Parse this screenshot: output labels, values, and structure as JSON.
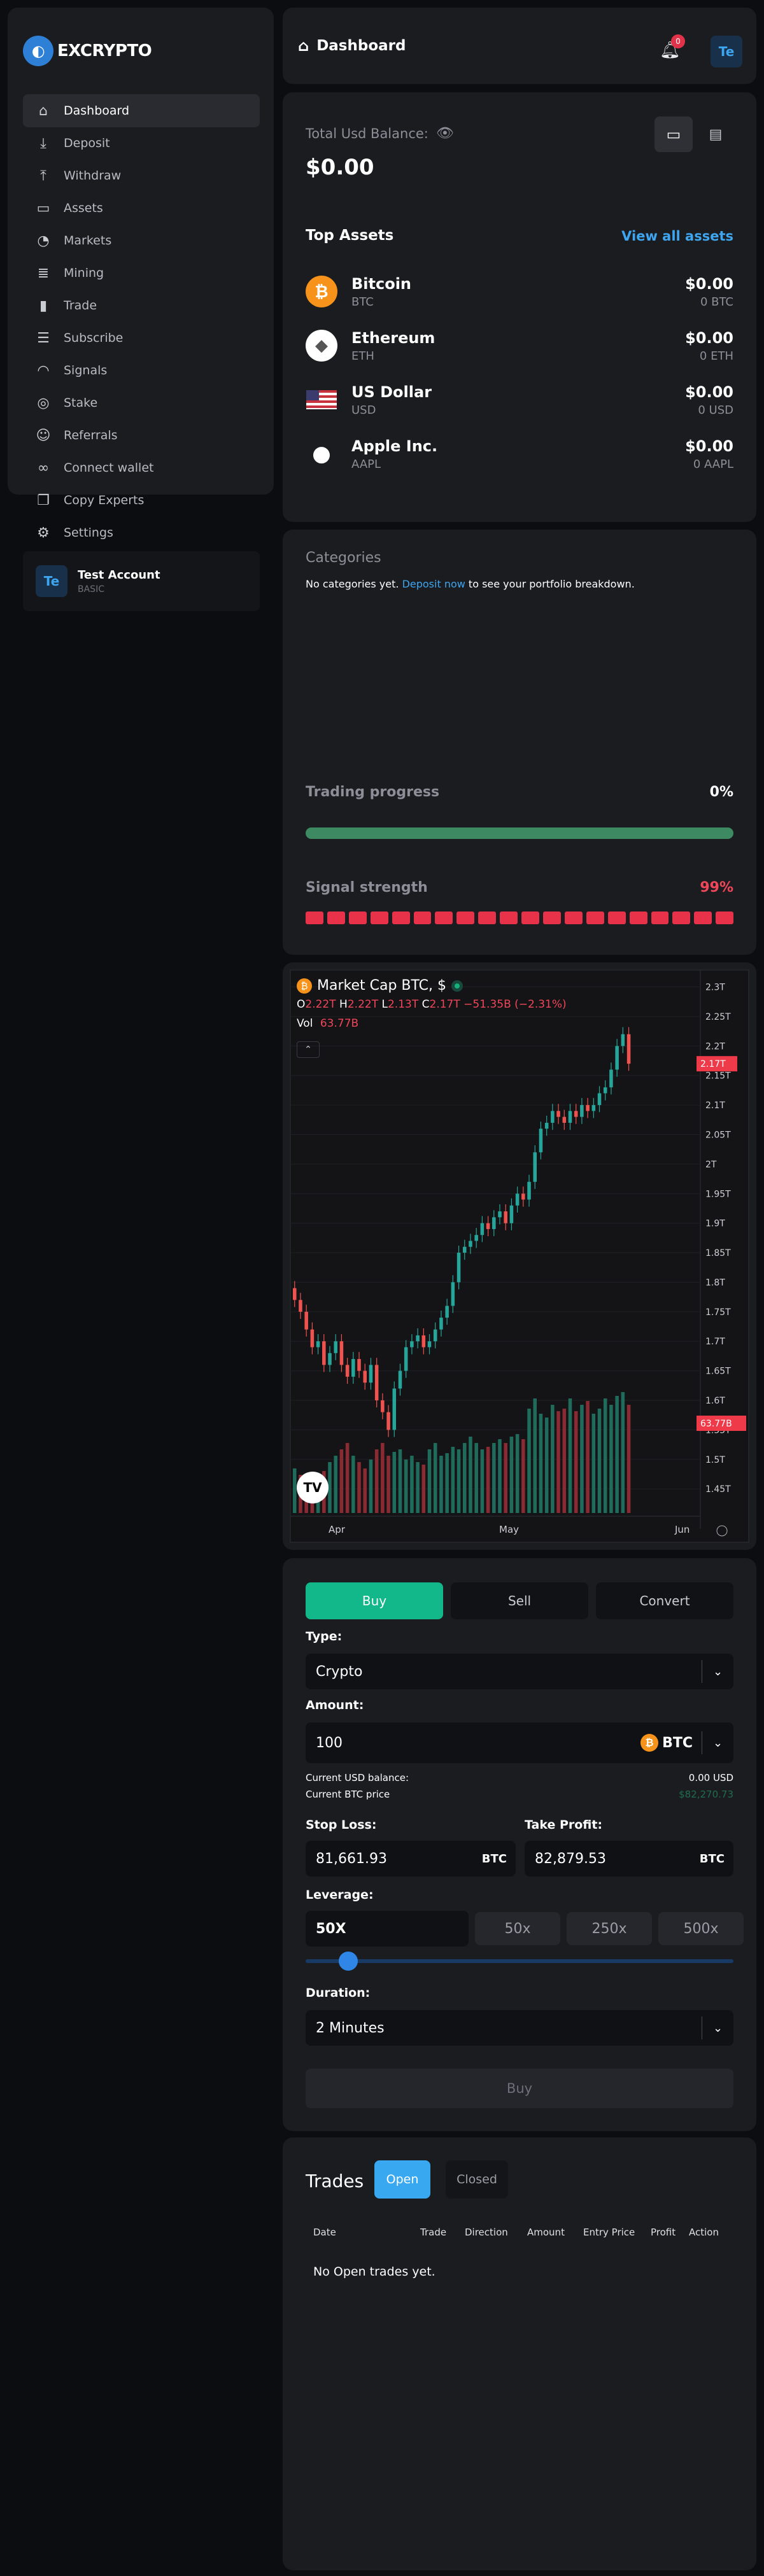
{
  "sidebar": {
    "brand": "EXCRYPTO",
    "items": [
      {
        "label": "Dashboard",
        "icon": "home-icon"
      },
      {
        "label": "Deposit",
        "icon": "deposit-icon"
      },
      {
        "label": "Withdraw",
        "icon": "withdraw-icon"
      },
      {
        "label": "Assets",
        "icon": "wallet-icon"
      },
      {
        "label": "Markets",
        "icon": "pie-chart-icon"
      },
      {
        "label": "Mining",
        "icon": "database-icon"
      },
      {
        "label": "Trade",
        "icon": "bar-chart-icon"
      },
      {
        "label": "Subscribe",
        "icon": "server-icon"
      },
      {
        "label": "Signals",
        "icon": "wifi-icon"
      },
      {
        "label": "Stake",
        "icon": "coins-icon"
      },
      {
        "label": "Referrals",
        "icon": "users-icon"
      },
      {
        "label": "Connect wallet",
        "icon": "link-icon"
      },
      {
        "label": "Copy Experts",
        "icon": "copy-icon"
      },
      {
        "label": "Settings",
        "icon": "gear-icon"
      }
    ],
    "account": {
      "avatar": "Te",
      "name": "Test Account",
      "tier": "BASIC"
    }
  },
  "topbar": {
    "title": "Dashboard",
    "notifications": "0",
    "avatar": "Te"
  },
  "balance": {
    "label": "Total Usd Balance:",
    "value": "$0.00",
    "top_assets_title": "Top Assets",
    "view_all": "View all assets",
    "assets": [
      {
        "name": "Bitcoin",
        "symbol": "BTC",
        "value": "$0.00",
        "amount": "0 BTC",
        "color": "#f7931a",
        "glyph": "₿"
      },
      {
        "name": "Ethereum",
        "symbol": "ETH",
        "value": "$0.00",
        "amount": "0 ETH",
        "color": "#ffffff",
        "glyph": "◆"
      },
      {
        "name": "US Dollar",
        "symbol": "USD",
        "value": "$0.00",
        "amount": "0 USD",
        "color": "#ffffff",
        "glyph": ""
      },
      {
        "name": "Apple Inc.",
        "symbol": "AAPL",
        "value": "$0.00",
        "amount": "0 AAPL",
        "color": "#1b1c20",
        "glyph": ""
      }
    ]
  },
  "categories": {
    "title": "Categories",
    "empty_pre": "No categories yet.",
    "empty_link": "Deposit now",
    "empty_post": "to see your portfolio breakdown.",
    "progress_label": "Trading progress",
    "progress_value": "0%",
    "progress_fraction": 0,
    "signal_label": "Signal strength",
    "signal_value": "99%",
    "signal_segments": 20
  },
  "chart_data": {
    "type": "candlestick",
    "title": "Market Cap BTC, $",
    "ohlc": {
      "o_label": "O",
      "o": "2.22T",
      "h_label": "H",
      "h": "2.22T",
      "l_label": "L",
      "l": "2.13T",
      "c_label": "C",
      "c": "2.17T",
      "change": "−51.35B (−2.31%)"
    },
    "vol_label": "Vol",
    "vol": "63.77B",
    "price_ticks": [
      "2.3T",
      "2.25T",
      "2.2T",
      "2.15T",
      "2.1T",
      "2.05T",
      "2T",
      "1.95T",
      "1.9T",
      "1.85T",
      "1.8T",
      "1.75T",
      "1.7T",
      "1.65T",
      "1.6T",
      "1.55T",
      "1.5T",
      "1.45T"
    ],
    "x_ticks": [
      "Apr",
      "May",
      "Jun"
    ],
    "last_price_tag": "2.17T",
    "last_volume_tag": "63.77B",
    "closes": [
      1.77,
      1.75,
      1.72,
      1.69,
      1.7,
      1.66,
      1.68,
      1.7,
      1.66,
      1.64,
      1.67,
      1.65,
      1.63,
      1.66,
      1.6,
      1.58,
      1.55,
      1.62,
      1.65,
      1.69,
      1.7,
      1.71,
      1.69,
      1.7,
      1.72,
      1.74,
      1.76,
      1.8,
      1.85,
      1.86,
      1.87,
      1.88,
      1.9,
      1.89,
      1.91,
      1.92,
      1.9,
      1.93,
      1.95,
      1.94,
      1.97,
      2.02,
      2.06,
      2.07,
      2.09,
      2.08,
      2.07,
      2.09,
      2.08,
      2.1,
      2.09,
      2.1,
      2.12,
      2.13,
      2.16,
      2.2,
      2.22,
      2.17
    ],
    "volumes": [
      0.35,
      0.3,
      0.25,
      0.28,
      0.3,
      0.33,
      0.4,
      0.45,
      0.5,
      0.55,
      0.45,
      0.4,
      0.35,
      0.42,
      0.5,
      0.55,
      0.45,
      0.48,
      0.5,
      0.42,
      0.45,
      0.4,
      0.38,
      0.5,
      0.55,
      0.45,
      0.47,
      0.52,
      0.5,
      0.55,
      0.6,
      0.55,
      0.5,
      0.52,
      0.55,
      0.58,
      0.55,
      0.6,
      0.62,
      0.58,
      0.82,
      0.9,
      0.78,
      0.75,
      0.85,
      0.8,
      0.82,
      0.9,
      0.8,
      0.85,
      0.88,
      0.78,
      0.82,
      0.9,
      0.85,
      0.92,
      0.95,
      0.85
    ]
  },
  "trade_form": {
    "tabs": [
      "Buy",
      "Sell",
      "Convert"
    ],
    "type_label": "Type:",
    "type_value": "Crypto",
    "amount_label": "Amount:",
    "amount_value": "100",
    "amount_currency": "BTC",
    "usd_balance_label": "Current USD balance:",
    "usd_balance": "0.00 USD",
    "btc_price_label": "Current BTC price",
    "btc_price": "$82,270.73",
    "stop_loss_label": "Stop Loss:",
    "stop_loss": "81,661.93",
    "stop_loss_unit": "BTC",
    "take_profit_label": "Take Profit:",
    "take_profit": "82,879.53",
    "take_profit_unit": "BTC",
    "leverage_label": "Leverage:",
    "leverage_value": "50X",
    "leverage_options": [
      "50x",
      "250x",
      "500x"
    ],
    "leverage_fraction": 0.07,
    "duration_label": "Duration:",
    "duration_value": "2 Minutes",
    "submit": "Buy"
  },
  "trades": {
    "title": "Trades",
    "tabs": [
      "Open",
      "Closed"
    ],
    "columns": [
      "Date",
      "Trade",
      "Direction",
      "Amount",
      "Entry Price",
      "Profit",
      "Action"
    ],
    "empty": "No Open trades yet."
  }
}
